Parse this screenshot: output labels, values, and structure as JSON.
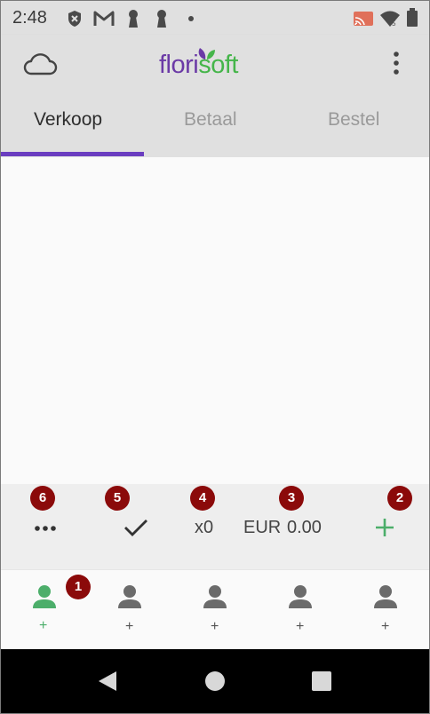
{
  "status_bar": {
    "time": "2:48",
    "icons": [
      "shield-x-icon",
      "gmail-icon",
      "keyhole-icon",
      "keyhole-icon",
      "dot-icon",
      "cast-icon",
      "wifi-icon",
      "battery-icon"
    ]
  },
  "header": {
    "logo_part1": "flori",
    "logo_part2": "soft",
    "menu_icon": "more-vert-icon",
    "cloud_icon": "cloud-icon"
  },
  "tabs": [
    {
      "label": "Verkoop",
      "active": true
    },
    {
      "label": "Betaal",
      "active": false
    },
    {
      "label": "Bestel",
      "active": false
    }
  ],
  "toolbar": {
    "more_icon": "more-horiz-icon",
    "check_icon": "check-icon",
    "quantity": "x0",
    "currency": "EUR",
    "amount": "0.00",
    "add_icon": "plus-icon"
  },
  "badges": [
    "1",
    "2",
    "3",
    "4",
    "5",
    "6"
  ],
  "customers": [
    {
      "label": "+",
      "active": true
    },
    {
      "label": "+",
      "active": false
    },
    {
      "label": "+",
      "active": false
    },
    {
      "label": "+",
      "active": false
    },
    {
      "label": "+",
      "active": false
    }
  ],
  "colors": {
    "accent": "#6a3dc0",
    "brand_purple": "#6b3aa6",
    "brand_green": "#45b54a",
    "badge": "#8b0a0a",
    "active_customer": "#4cae6a"
  }
}
